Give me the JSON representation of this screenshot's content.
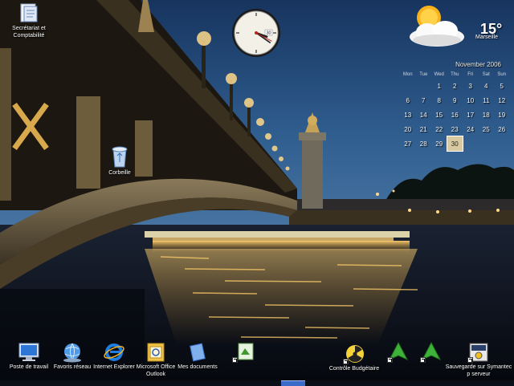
{
  "desktop": {
    "top_icons": [
      {
        "label": "Secrétariat et Comptabilité",
        "icon": "folder-doc-icon"
      },
      {
        "label": "Corbeille",
        "icon": "recycle-bin-icon"
      }
    ],
    "bottom_icons": [
      {
        "label": "Poste de travail",
        "icon": "monitor-icon"
      },
      {
        "label": "Favoris réseau",
        "icon": "network-globe-icon"
      },
      {
        "label": "Internet Explorer",
        "icon": "internet-explorer-icon"
      },
      {
        "label": "Microsoft Office Outlook",
        "icon": "outlook-icon"
      },
      {
        "label": "Mes documents",
        "icon": "documents-icon"
      },
      {
        "label": "",
        "icon": "green-app-icon"
      },
      {
        "label": "Contrôle Budgétaire",
        "icon": "radiation-icon"
      },
      {
        "label": "",
        "icon": "green-arrow-icon"
      },
      {
        "label": "",
        "icon": "green-arrow-icon"
      },
      {
        "label": "Sauvegarde sur Symantec p serveur",
        "icon": "backup-icon"
      }
    ]
  },
  "weather": {
    "temperature": "15°",
    "city": "Marseille",
    "condition_icon": "sun-cloud-icon"
  },
  "clock": {
    "hour_hand_deg": 110,
    "minute_hand_deg": 125,
    "second_hand_deg": 118,
    "date_badge": "30"
  },
  "calendar": {
    "month_title": "November 2006",
    "weekdays": [
      "Mon",
      "Tue",
      "Wed",
      "Thu",
      "Fri",
      "Sat",
      "Sun"
    ],
    "weeks": [
      [
        "",
        "",
        "1",
        "2",
        "3",
        "4",
        "5"
      ],
      [
        "6",
        "7",
        "8",
        "9",
        "10",
        "11",
        "12"
      ],
      [
        "13",
        "14",
        "15",
        "16",
        "17",
        "18",
        "19"
      ],
      [
        "20",
        "21",
        "22",
        "23",
        "24",
        "25",
        "26"
      ],
      [
        "27",
        "28",
        "29",
        "30",
        "",
        "",
        ""
      ]
    ],
    "today": "30"
  },
  "colors": {
    "sky_top": "#1d3d6e",
    "sky_bottom": "#3c6c9e",
    "water": "#0d1424",
    "bridge_gold": "#b08a4a",
    "calendar_highlight": "#d9c9a0"
  }
}
